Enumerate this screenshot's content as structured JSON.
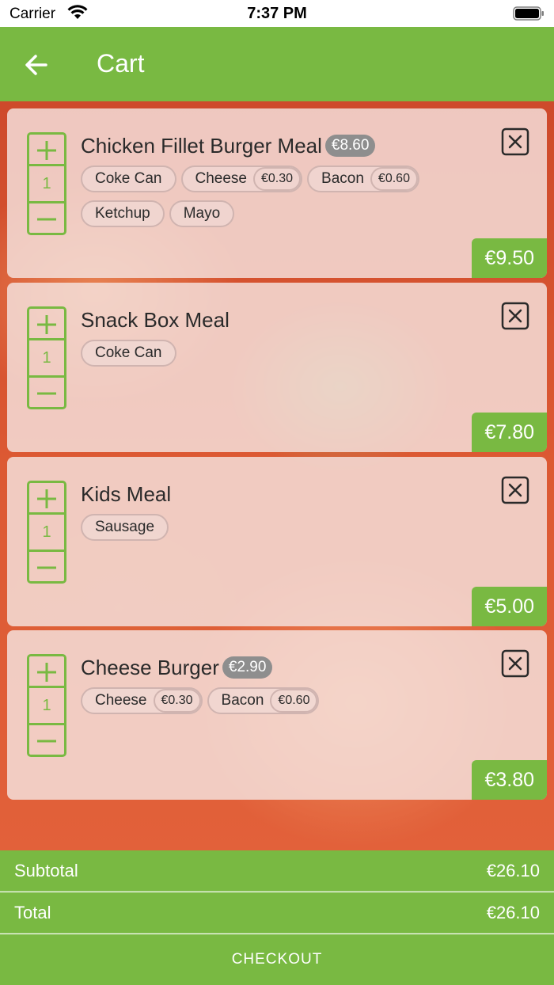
{
  "status_bar": {
    "carrier": "Carrier",
    "time": "7:37 PM"
  },
  "nav": {
    "title": "Cart"
  },
  "colors": {
    "accent": "#79b942",
    "badge": "#8e8e8e"
  },
  "cart_items": [
    {
      "name": "Chicken Fillet Burger Meal",
      "price_badge": "€8.60",
      "quantity": "1",
      "options": [
        {
          "label": "Coke Can"
        },
        {
          "label": "Cheese",
          "price": "€0.30"
        },
        {
          "label": "Bacon",
          "price": "€0.60"
        },
        {
          "label": "Ketchup"
        },
        {
          "label": "Mayo"
        }
      ],
      "total": "€9.50"
    },
    {
      "name": "Snack Box Meal",
      "quantity": "1",
      "options": [
        {
          "label": "Coke Can"
        }
      ],
      "total": "€7.80"
    },
    {
      "name": "Kids Meal",
      "quantity": "1",
      "options": [
        {
          "label": "Sausage"
        }
      ],
      "total": "€5.00"
    },
    {
      "name": "Cheese Burger",
      "price_badge": "€2.90",
      "quantity": "1",
      "options": [
        {
          "label": "Cheese",
          "price": "€0.30"
        },
        {
          "label": "Bacon",
          "price": "€0.60"
        }
      ],
      "total": "€3.80"
    }
  ],
  "summary": {
    "subtotal_label": "Subtotal",
    "subtotal_value": "€26.10",
    "total_label": "Total",
    "total_value": "€26.10"
  },
  "checkout_label": "CHECKOUT"
}
